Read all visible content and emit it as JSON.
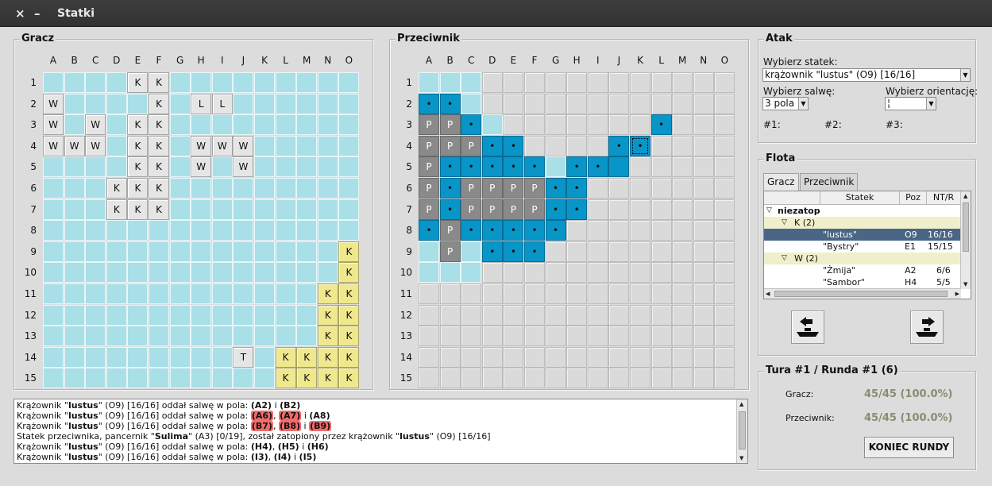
{
  "window": {
    "title": "Statki",
    "close_glyph": "×",
    "min_glyph": "–"
  },
  "columns": [
    "A",
    "B",
    "C",
    "D",
    "E",
    "F",
    "G",
    "H",
    "I",
    "J",
    "K",
    "L",
    "M",
    "N",
    "O"
  ],
  "rows": [
    "1",
    "2",
    "3",
    "4",
    "5",
    "6",
    "7",
    "8",
    "9",
    "10",
    "11",
    "12",
    "13",
    "14",
    "15"
  ],
  "player": {
    "title": "Gracz",
    "cells": [
      {
        "c": "E",
        "r": 1,
        "t": "K"
      },
      {
        "c": "F",
        "r": 1,
        "t": "K"
      },
      {
        "c": "A",
        "r": 2,
        "t": "W"
      },
      {
        "c": "F",
        "r": 2,
        "t": "K"
      },
      {
        "c": "H",
        "r": 2,
        "t": "L"
      },
      {
        "c": "I",
        "r": 2,
        "t": "L"
      },
      {
        "c": "A",
        "r": 3,
        "t": "W"
      },
      {
        "c": "C",
        "r": 3,
        "t": "W"
      },
      {
        "c": "E",
        "r": 3,
        "t": "K"
      },
      {
        "c": "F",
        "r": 3,
        "t": "K"
      },
      {
        "c": "A",
        "r": 4,
        "t": "W"
      },
      {
        "c": "B",
        "r": 4,
        "t": "W"
      },
      {
        "c": "C",
        "r": 4,
        "t": "W"
      },
      {
        "c": "E",
        "r": 4,
        "t": "K"
      },
      {
        "c": "F",
        "r": 4,
        "t": "K"
      },
      {
        "c": "H",
        "r": 4,
        "t": "W"
      },
      {
        "c": "I",
        "r": 4,
        "t": "W"
      },
      {
        "c": "J",
        "r": 4,
        "t": "W"
      },
      {
        "c": "E",
        "r": 5,
        "t": "K"
      },
      {
        "c": "F",
        "r": 5,
        "t": "K"
      },
      {
        "c": "H",
        "r": 5,
        "t": "W"
      },
      {
        "c": "J",
        "r": 5,
        "t": "W"
      },
      {
        "c": "D",
        "r": 6,
        "t": "K"
      },
      {
        "c": "E",
        "r": 6,
        "t": "K"
      },
      {
        "c": "F",
        "r": 6,
        "t": "K"
      },
      {
        "c": "D",
        "r": 7,
        "t": "K"
      },
      {
        "c": "E",
        "r": 7,
        "t": "K"
      },
      {
        "c": "F",
        "r": 7,
        "t": "K"
      },
      {
        "c": "O",
        "r": 9,
        "t": "K",
        "y": 1
      },
      {
        "c": "O",
        "r": 10,
        "t": "K",
        "y": 1
      },
      {
        "c": "N",
        "r": 11,
        "t": "K",
        "y": 1
      },
      {
        "c": "O",
        "r": 11,
        "t": "K",
        "y": 1
      },
      {
        "c": "N",
        "r": 12,
        "t": "K",
        "y": 1
      },
      {
        "c": "O",
        "r": 12,
        "t": "K",
        "y": 1
      },
      {
        "c": "N",
        "r": 13,
        "t": "K",
        "y": 1
      },
      {
        "c": "O",
        "r": 13,
        "t": "K",
        "y": 1
      },
      {
        "c": "J",
        "r": 14,
        "t": "T"
      },
      {
        "c": "L",
        "r": 14,
        "t": "K",
        "y": 1
      },
      {
        "c": "M",
        "r": 14,
        "t": "K",
        "y": 1
      },
      {
        "c": "N",
        "r": 14,
        "t": "K",
        "y": 1
      },
      {
        "c": "O",
        "r": 14,
        "t": "K",
        "y": 1
      },
      {
        "c": "L",
        "r": 15,
        "t": "K",
        "y": 1
      },
      {
        "c": "M",
        "r": 15,
        "t": "K",
        "y": 1
      },
      {
        "c": "N",
        "r": 15,
        "t": "K",
        "y": 1
      },
      {
        "c": "O",
        "r": 15,
        "t": "K",
        "y": 1
      }
    ]
  },
  "opponent": {
    "title": "Przeciwnik",
    "map": [
      "mmm............",
      "hhm............",
      "PPhm.......h...",
      "PPPhh....hs....",
      "PhhhhhmhhH.....",
      "PhPPPPhh.......",
      "PhPPPPhh.......",
      "hPhhhhh........",
      "mPmhhh.........",
      "mmm............",
      "...............",
      "...............",
      "...............",
      "...............",
      "..............."
    ],
    "sunk_mark": "P",
    "hit_mark": "•"
  },
  "attack": {
    "title": "Atak",
    "choose_ship_label": "Wybierz statek:",
    "ship_value": "krążownik \"lustus\" (O9) [16/16]",
    "salvo_label": "Wybierz salwę:",
    "salvo_value": "3 pola",
    "orientation_label": "Wybierz orientację:",
    "orientation_value": "¦",
    "shot1": "#1:",
    "shot2": "#2:",
    "shot3": "#3:"
  },
  "fleet": {
    "title": "Flota",
    "tabs": [
      "Gracz",
      "Przeciwnik"
    ],
    "headers": [
      "Statek",
      "Poz",
      "NT/R"
    ],
    "root": "niezatop",
    "groups": [
      {
        "label": "K (2)",
        "ships": [
          {
            "name": "\"lustus\"",
            "pos": "O9",
            "nt": "16/16",
            "selected": true
          },
          {
            "name": "\"Bystry\"",
            "pos": "E1",
            "nt": "15/15"
          }
        ]
      },
      {
        "label": "W (2)",
        "ships": [
          {
            "name": "\"Żmija\"",
            "pos": "A2",
            "nt": "6/6"
          },
          {
            "name": "\"Sambor\"",
            "pos": "H4",
            "nt": "5/5"
          }
        ]
      }
    ]
  },
  "turn": {
    "title": "Tura #1 / Runda #1 (6)",
    "player_label": "Gracz:",
    "player_value": "45/45 (100.0%)",
    "opponent_label": "Przeciwnik:",
    "opponent_value": "45/45 (100.0%)",
    "end_button": "KONIEC RUNDY"
  },
  "log": [
    [
      [
        "t",
        "Krążownik \""
      ],
      [
        "b",
        "lustus"
      ],
      [
        "t",
        "\" (O9) [16/16] oddał salwę w pola: "
      ],
      [
        "b",
        "(A2)"
      ],
      [
        "t",
        " i "
      ],
      [
        "b",
        "(B2)"
      ]
    ],
    [
      [
        "t",
        "Krążownik \""
      ],
      [
        "b",
        "lustus"
      ],
      [
        "t",
        "\" (O9) [16/16] oddał salwę w pola: "
      ],
      [
        "h",
        "(A6)"
      ],
      [
        "t",
        ", "
      ],
      [
        "h",
        "(A7)"
      ],
      [
        "t",
        " i "
      ],
      [
        "b",
        "(A8)"
      ]
    ],
    [
      [
        "t",
        "Krążownik \""
      ],
      [
        "b",
        "lustus"
      ],
      [
        "t",
        "\" (O9) [16/16] oddał salwę w pola: "
      ],
      [
        "h",
        "(B7)"
      ],
      [
        "t",
        ", "
      ],
      [
        "h",
        "(B8)"
      ],
      [
        "t",
        " i "
      ],
      [
        "h",
        "(B9)"
      ]
    ],
    [
      [
        "t",
        "Statek przeciwnika, pancernik \""
      ],
      [
        "b",
        "Sulima"
      ],
      [
        "t",
        "\" (A3) [0/19], został zatopiony przez krążownik \""
      ],
      [
        "b",
        "lustus"
      ],
      [
        "t",
        "\" (O9) [16/16]"
      ]
    ],
    [
      [
        "t",
        "Krążownik \""
      ],
      [
        "b",
        "lustus"
      ],
      [
        "t",
        "\" (O9) [16/16] oddał salwę w pola: "
      ],
      [
        "b",
        "(H4)"
      ],
      [
        "t",
        ", "
      ],
      [
        "b",
        "(H5)"
      ],
      [
        "t",
        " i "
      ],
      [
        "b",
        "(H6)"
      ]
    ],
    [
      [
        "t",
        "Krążownik \""
      ],
      [
        "b",
        "lustus"
      ],
      [
        "t",
        "\" (O9) [16/16] oddał salwę w pola: "
      ],
      [
        "b",
        "(I3)"
      ],
      [
        "t",
        ", "
      ],
      [
        "b",
        "(I4)"
      ],
      [
        "t",
        " i "
      ],
      [
        "b",
        "(I5)"
      ]
    ]
  ]
}
